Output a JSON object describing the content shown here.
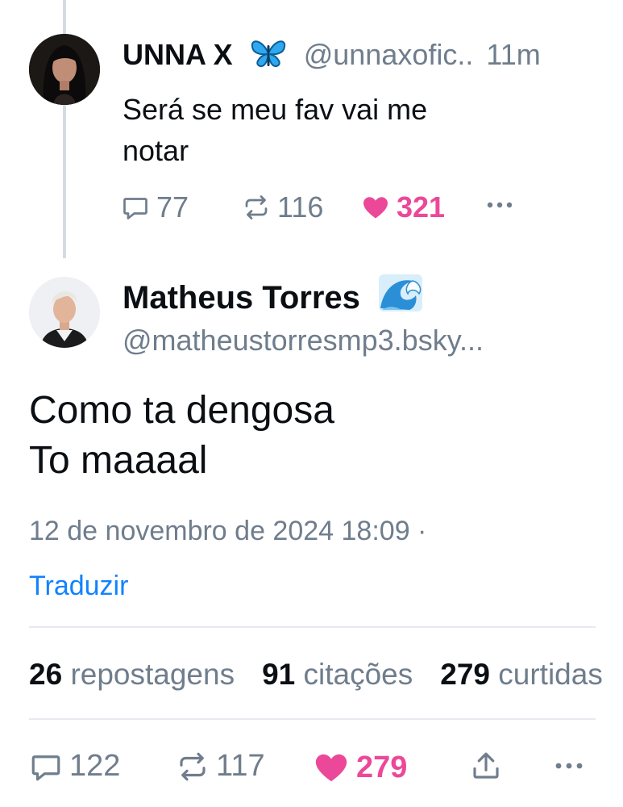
{
  "parent_post": {
    "display_name": "UNNA X",
    "handle": "@unnaxofic..",
    "time": "11m",
    "text_line1": "Será se meu fav vai me",
    "text_line2": "notar",
    "replies": "77",
    "reposts": "116",
    "likes": "321"
  },
  "main_post": {
    "display_name": "Matheus Torres",
    "handle": "@matheustorresmp3.bsky...",
    "text_line1": "Como ta dengosa",
    "text_line2": "To maaaal",
    "timestamp": "12 de novembro de 2024 18:09 ·",
    "translate_label": "Traduzir"
  },
  "stats": {
    "reposts_count": "26",
    "reposts_label": "repostagens",
    "quotes_count": "91",
    "quotes_label": "citações",
    "likes_count": "279",
    "likes_label": "curtidas"
  },
  "actions": {
    "replies": "122",
    "reposts": "117",
    "likes": "279"
  },
  "colors": {
    "like_pink": "#ec4899",
    "link_blue": "#1083fe",
    "muted_gray": "#6f7d8c",
    "text_dark": "#0b0f14"
  }
}
